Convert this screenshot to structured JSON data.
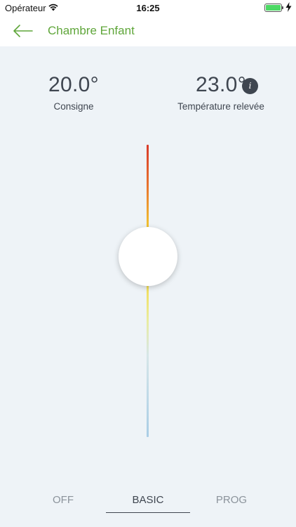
{
  "status_bar": {
    "carrier": "Opérateur",
    "time": "16:25",
    "battery_level": 1.0,
    "charging": true,
    "battery_color": "#4cd964"
  },
  "nav": {
    "title": "Chambre Enfant",
    "back_icon": "arrow-left-icon",
    "title_color": "#5fa63a"
  },
  "setpoint": {
    "value": "20.0°",
    "label": "Consigne"
  },
  "measured": {
    "value": "23.0°",
    "label": "Température relevée",
    "info_icon": "i"
  },
  "slider": {
    "level": 0.38,
    "colors": [
      "#d93a2a",
      "#f2c431",
      "#f2dd55",
      "#a9cde6"
    ]
  },
  "modes": {
    "off": "OFF",
    "basic": "BASIC",
    "prog": "PROG",
    "selected": "BASIC"
  }
}
